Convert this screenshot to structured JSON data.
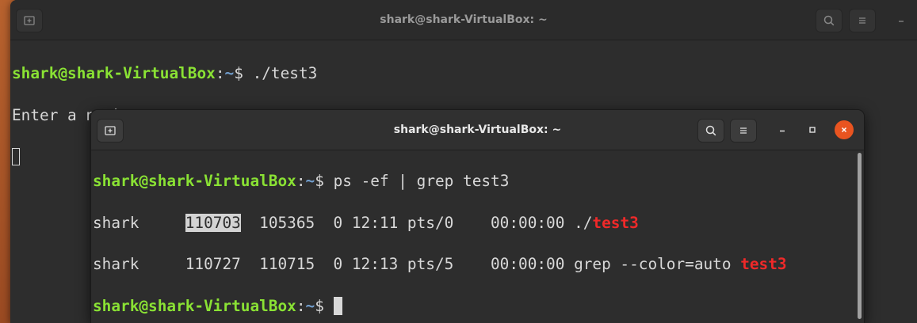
{
  "back_window": {
    "title": "shark@shark-VirtualBox: ~",
    "prompt_user": "shark@shark-VirtualBox",
    "prompt_sep": ":",
    "prompt_path": "~",
    "prompt_symbol": "$",
    "command": " ./test3",
    "output": "Enter a number:"
  },
  "front_window": {
    "title": "shark@shark-VirtualBox: ~",
    "prompt_user": "shark@shark-VirtualBox",
    "prompt_sep": ":",
    "prompt_path": "~",
    "prompt_symbol": "$",
    "command": " ps -ef | grep test3",
    "rows": [
      {
        "user": "shark",
        "gap1": "     ",
        "pid": "110703",
        "rest": "  105365  0 12:11 pts/0    00:00:00 ./",
        "match": "test3"
      },
      {
        "user": "shark",
        "gap1": "     ",
        "pid": "110727",
        "rest": "  110715  0 12:13 pts/5    00:00:00 grep --color=auto ",
        "match": "test3"
      }
    ]
  },
  "colors": {
    "prompt_user": "#8ae234",
    "prompt_path": "#729fcf",
    "grep_match": "#ef2929",
    "close_button": "#e95420",
    "desktop": "#b8622e"
  },
  "icons": [
    "new-tab-icon",
    "search-icon",
    "hamburger-menu-icon",
    "minimize-icon",
    "maximize-icon",
    "close-icon"
  ]
}
